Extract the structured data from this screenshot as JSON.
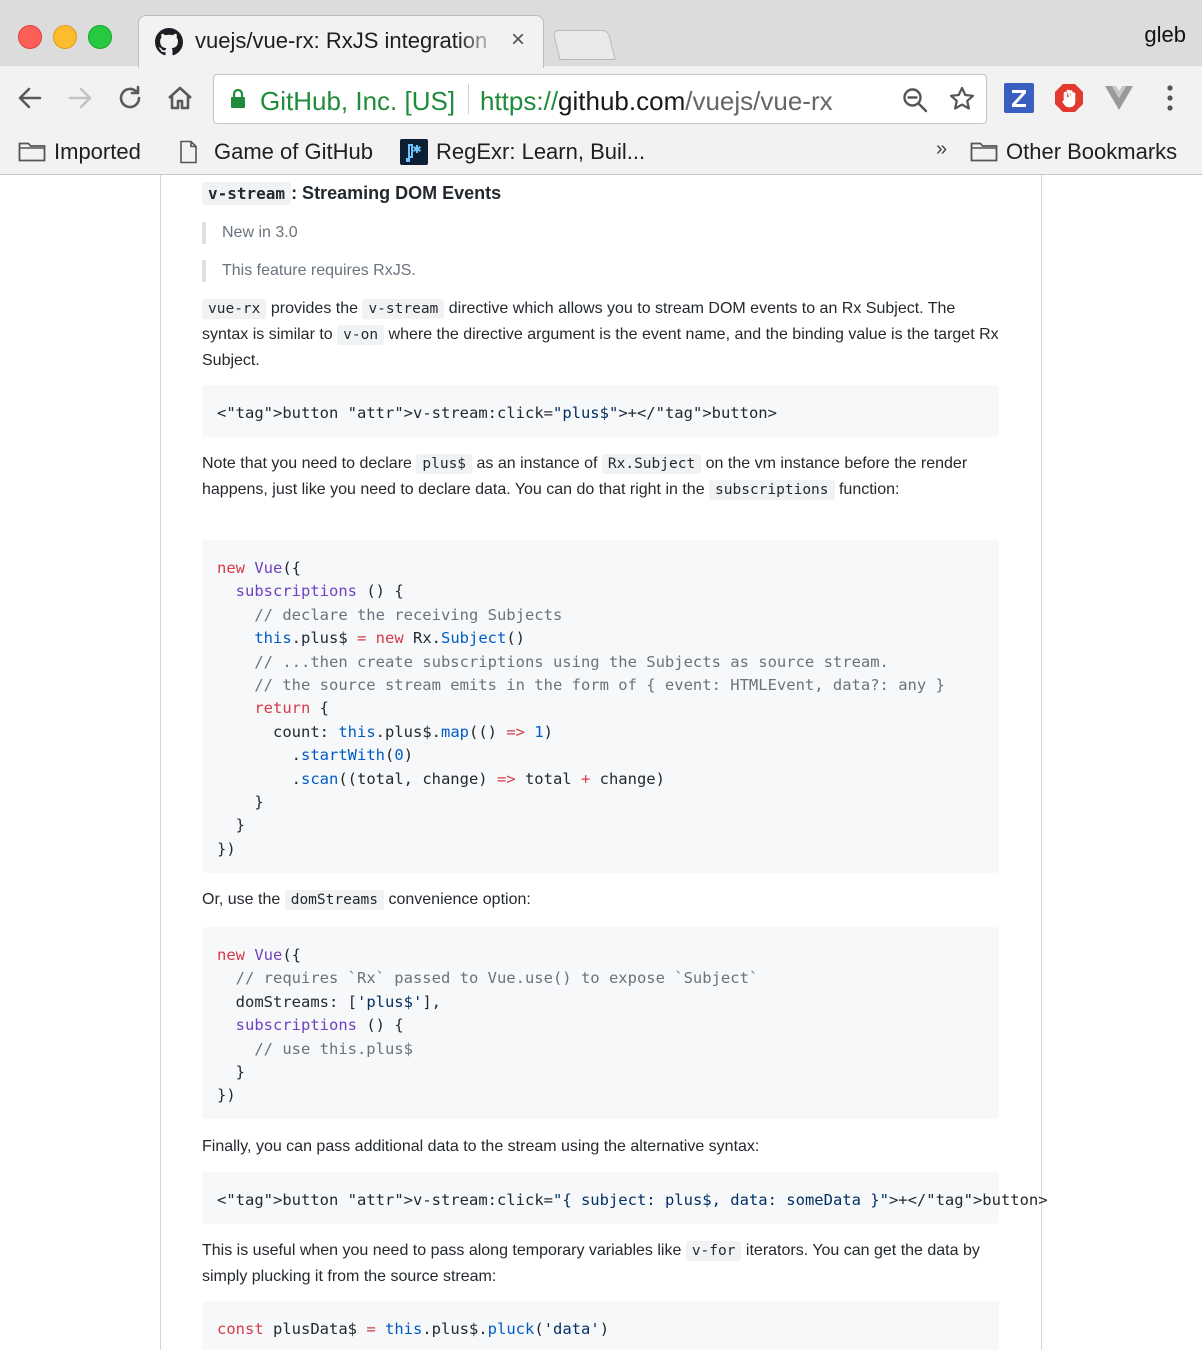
{
  "browser": {
    "tab_title": "vuejs/vue-rx: RxJS integration",
    "tab_close": "×",
    "user_name": "gleb",
    "site_identity": "GitHub, Inc. [US]",
    "url_scheme": "https://",
    "url_host": "github.com",
    "url_path": "/vuejs/vue-rx",
    "bookmarks": [
      {
        "label": "Imported",
        "icon": "folder-icon"
      },
      {
        "label": "Game of GitHub",
        "icon": "page-icon"
      },
      {
        "label": "RegExr: Learn, Buil...",
        "icon": "regexr-icon"
      }
    ],
    "bookmarks_overflow": "»",
    "other_bookmarks": "Other Bookmarks",
    "extensions": [
      "zotero-icon",
      "stop-hand-icon",
      "vue-devtools-icon"
    ],
    "colors": {
      "secure_green": "#1e8c3a",
      "close": "#fc5f57",
      "minimize": "#fdbc2e",
      "maximize": "#27c940"
    }
  },
  "article": {
    "heading_code": "v-stream",
    "heading_text": ": Streaming DOM Events",
    "note_new": "New in 3.0",
    "note_requires": "This feature requires RxJS.",
    "intro": {
      "c1": "vue-rx",
      "t1": " provides the ",
      "c2": "v-stream",
      "t2": " directive which allows you to stream DOM events to an Rx Subject. The syntax is similar to ",
      "c3": "v-on",
      "t3": " where the directive argument is the event name, and the binding value is the target Rx Subject."
    },
    "note": {
      "t1": "Note that you need to declare ",
      "c1": "plus$",
      "t2": " as an instance of ",
      "c2": "Rx.Subject",
      "t3": " on the vm instance before the render happens, just like you need to declare data. You can do that right in the ",
      "c3": "subscriptions",
      "t4": " function:"
    },
    "or": {
      "t1": "Or, use the ",
      "c1": "domStreams",
      "t2": " convenience option:"
    },
    "finally": "Finally, you can pass additional data to the stream using the alternative syntax:",
    "useful": {
      "t1": "This is useful when you need to pass along temporary variables like ",
      "c1": "v-for",
      "t2": " iterators. You can get the data by simply plucking it from the source stream:"
    },
    "code_button1": "<button v-stream:click=\"plus$\">+</button>",
    "code_subscriptions": "new Vue({\n  subscriptions () {\n    // declare the receiving Subjects\n    this.plus$ = new Rx.Subject()\n    // ...then create subscriptions using the Subjects as source stream.\n    // the source stream emits in the form of { event: HTMLEvent, data?: any }\n    return {\n      count: this.plus$.map(() => 1)\n        .startWith(0)\n        .scan((total, change) => total + change)\n    }\n  }\n})",
    "code_domstreams": "new Vue({\n  // requires `Rx` passed to Vue.use() to expose `Subject`\n  domStreams: ['plus$'],\n  subscriptions () {\n    // use this.plus$\n  }\n})",
    "code_button2": "<button v-stream:click=\"{ subject: plus$, data: someData }\">+</button>",
    "code_pluck": "const plusData$ = this.plus$.pluck('data')"
  }
}
